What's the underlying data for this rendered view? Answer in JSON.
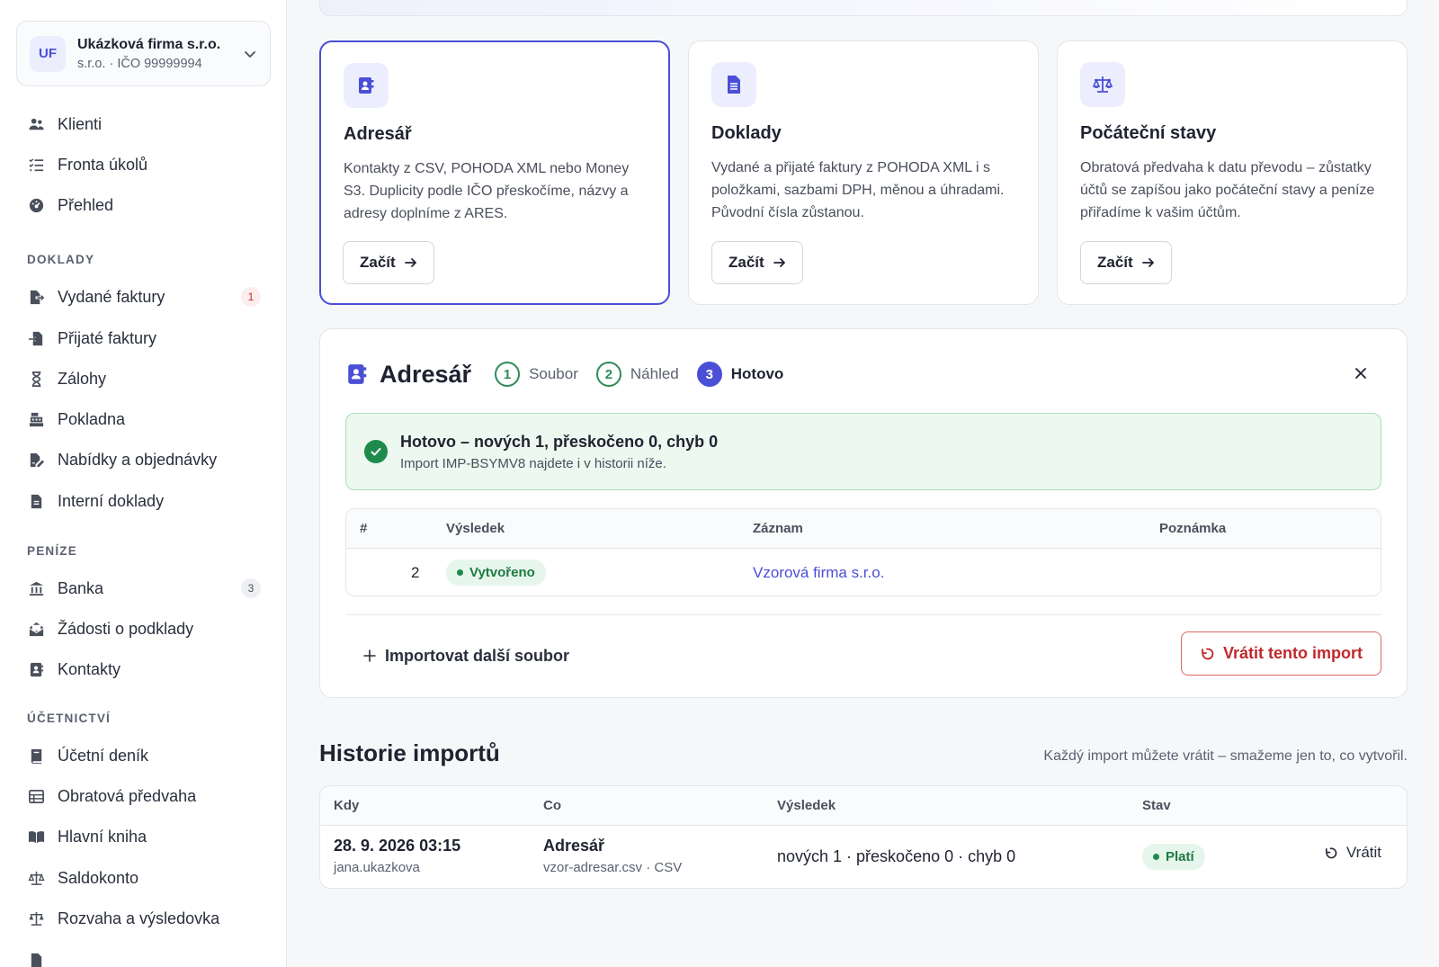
{
  "org": {
    "initials": "UF",
    "name": "Ukázková firma s.r.o.",
    "sub": "s.r.o. · IČO 99999994"
  },
  "nav": {
    "top": [
      {
        "label": "Klienti",
        "icon": "users-icon"
      },
      {
        "label": "Fronta úkolů",
        "icon": "tasks-icon"
      },
      {
        "label": "Přehled",
        "icon": "gauge-icon"
      }
    ],
    "sections": {
      "doklady": "DOKLADY",
      "penize": "PENÍZE",
      "ucetnictvi": "ÚČETNICTVÍ"
    },
    "doklady": [
      {
        "label": "Vydané faktury",
        "icon": "file-export-icon",
        "badge": "1"
      },
      {
        "label": "Přijaté faktury",
        "icon": "file-import-icon"
      },
      {
        "label": "Zálohy",
        "icon": "hourglass-icon"
      },
      {
        "label": "Pokladna",
        "icon": "cash-register-icon"
      },
      {
        "label": "Nabídky a objednávky",
        "icon": "file-signature-icon"
      },
      {
        "label": "Interní doklady",
        "icon": "file-icon"
      }
    ],
    "penize": [
      {
        "label": "Banka",
        "icon": "bank-icon",
        "badge": "3"
      },
      {
        "label": "Žádosti o podklady",
        "icon": "envelope-open-icon"
      },
      {
        "label": "Kontakty",
        "icon": "address-book-icon"
      }
    ],
    "ucetnictvi": [
      {
        "label": "Účetní deník",
        "icon": "book-icon"
      },
      {
        "label": "Obratová předvaha",
        "icon": "table-icon"
      },
      {
        "label": "Hlavní kniha",
        "icon": "book-open-icon"
      },
      {
        "label": "Saldokonto",
        "icon": "scale-icon"
      },
      {
        "label": "Rozvaha a výsledovka",
        "icon": "scale-balanced-icon"
      }
    ]
  },
  "cards": [
    {
      "title": "Adresář",
      "desc": "Kontakty z CSV, POHODA XML nebo Money S3. Duplicity podle IČO přeskočíme, názvy a adresy doplníme z ARES.",
      "button": "Začít",
      "icon": "address-book-icon"
    },
    {
      "title": "Doklady",
      "desc": "Vydané a přijaté faktury z POHODA XML i s položkami, sazbami DPH, měnou a úhradami. Původní čísla zůstanou.",
      "button": "Začít",
      "icon": "file-lines-icon"
    },
    {
      "title": "Počáteční stavy",
      "desc": "Obratová předvaha k datu převodu – zůstatky účtů se zapíšou jako počáteční stavy a peníze přiřadíme k vašim účtům.",
      "button": "Začít",
      "icon": "scale-balanced-icon"
    }
  ],
  "panel": {
    "title": "Adresář",
    "steps": [
      {
        "num": "1",
        "label": "Soubor"
      },
      {
        "num": "2",
        "label": "Náhled"
      },
      {
        "num": "3",
        "label": "Hotovo"
      }
    ],
    "success_title": "Hotovo – nových 1, přeskočeno 0, chyb 0",
    "success_sub": "Import IMP-BSYMV8 najdete i v historii níže.",
    "table": {
      "headers": [
        "#",
        "Výsledek",
        "Záznam",
        "Poznámka"
      ],
      "row": {
        "num": "2",
        "result": "Vytvořeno",
        "record": "Vzorová firma s.r.o.",
        "note": ""
      }
    },
    "import_more": "Importovat další soubor",
    "revert": "Vrátit tento import"
  },
  "history": {
    "title": "Historie importů",
    "note": "Každý import můžete vrátit – smažeme jen to, co vytvořil.",
    "headers": [
      "Kdy",
      "Co",
      "Výsledek",
      "Stav"
    ],
    "row": {
      "when": "28. 9. 2026 03:15",
      "user": "jana.ukazkova",
      "what": "Adresář",
      "file": "vzor-adresar.csv · CSV",
      "result": "nových 1 · přeskočeno 0 · chyb 0",
      "status": "Platí",
      "action": "Vrátit"
    }
  },
  "colors": {
    "accent": "#4a4fd6",
    "success": "#1e8a4c",
    "danger": "#c0282d"
  }
}
